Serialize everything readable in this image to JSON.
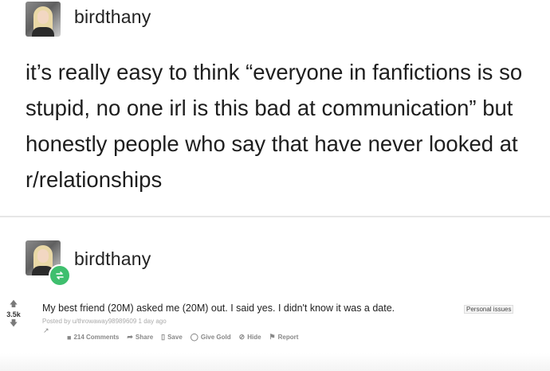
{
  "post1": {
    "username": "birdthany",
    "text": "it’s really easy to think “everyone in fanfictions is so stupid, no one irl is this bad at communication” but honestly people who say that have never looked at r/relationships"
  },
  "post2": {
    "username": "birdthany",
    "reddit": {
      "score": "3.5k",
      "title": "My best friend (20M) asked me (20M) out. I said yes. I didn't know it was a date.",
      "flair": "Personal issues",
      "meta": "Posted by u/throwaway98989609 1 day ago",
      "actions": [
        {
          "icon": "comment-icon",
          "label": "214 Comments"
        },
        {
          "icon": "share-icon",
          "label": "Share"
        },
        {
          "icon": "bookmark-icon",
          "label": "Save"
        },
        {
          "icon": "gold-icon",
          "label": "Give Gold"
        },
        {
          "icon": "hide-icon",
          "label": "Hide"
        },
        {
          "icon": "flag-icon",
          "label": "Report"
        }
      ]
    }
  },
  "colors": {
    "reblog_green": "#3fbf6e",
    "divider": "#e6e6e6"
  }
}
